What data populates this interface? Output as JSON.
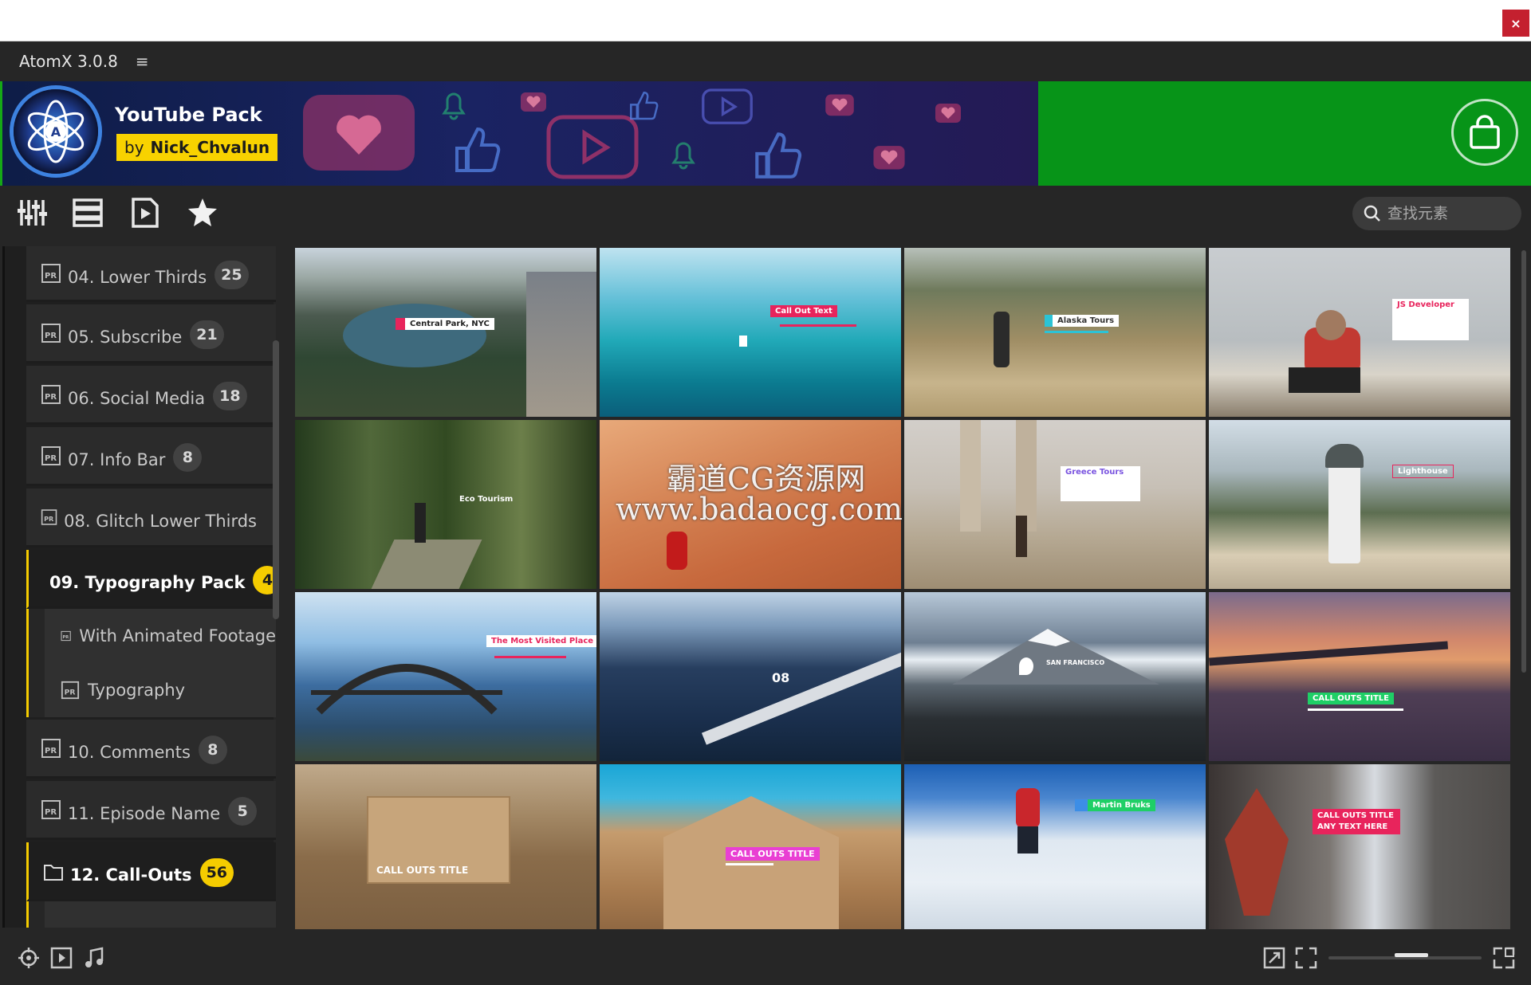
{
  "window": {
    "close_label": "×"
  },
  "app": {
    "title": "AtomX 3.0.8",
    "menu_icon": "hamburger-icon"
  },
  "banner": {
    "pack_title": "YouTube Pack",
    "author_prefix": "by",
    "author_name": "Nick_Chvalun",
    "accent_color": "#079418",
    "badge_color": "#f8d200"
  },
  "toolbar": {
    "icons": [
      "sliders-icon",
      "list-icon",
      "video-file-icon",
      "star-icon"
    ],
    "search_placeholder": "查找元素"
  },
  "sidebar": {
    "items": [
      {
        "label": "04. Lower Thirds",
        "count": "25"
      },
      {
        "label": "05. Subscribe",
        "count": "21"
      },
      {
        "label": "06. Social Media",
        "count": "18"
      },
      {
        "label": "07. Info Bar",
        "count": "8"
      },
      {
        "label": "08. Glitch Lower Thirds",
        "count": ""
      },
      {
        "label": "09. Typography Pack",
        "count": "4"
      },
      {
        "label": "10. Comments",
        "count": "8"
      },
      {
        "label": "11. Episode Name",
        "count": "5"
      },
      {
        "label": "12. Call-Outs",
        "count": "56"
      }
    ],
    "subitems": [
      {
        "label": "With Animated Footage"
      },
      {
        "label": "Typography"
      }
    ],
    "active_color": "#f5cc00"
  },
  "grid": {
    "tiles": [
      {
        "scene": "city-lake-aerial",
        "caption": "Central Park, NYC",
        "accent": "#e8245c"
      },
      {
        "scene": "turquoise-sea",
        "caption": "Call Out Text",
        "accent": "#e8245c"
      },
      {
        "scene": "hiker-hillside",
        "caption": "Alaska Tours",
        "accent": "#2bc3d6"
      },
      {
        "scene": "developer-desk",
        "caption": "JS Developer",
        "accent": "#e8245c"
      },
      {
        "scene": "forest-path",
        "caption": "Eco Tourism",
        "accent": "#ffffff"
      },
      {
        "scene": "desert-dunes",
        "caption": "",
        "accent": "#ffffff"
      },
      {
        "scene": "ancient-ruins",
        "caption": "Greece Tours",
        "accent": "#7a54e0"
      },
      {
        "scene": "lighthouse-coast",
        "caption": "Lighthouse",
        "accent": "#e8245c"
      },
      {
        "scene": "harbour-bridge",
        "caption": "The Most Visited Place",
        "accent": "#e8245c"
      },
      {
        "scene": "long-bridge",
        "caption": "08",
        "accent": "#3c6cf0"
      },
      {
        "scene": "mountain-town",
        "caption": "SAN FRANCISCO",
        "accent": "#ffffff"
      },
      {
        "scene": "sunset-bridge",
        "caption": "CALL OUTS TITLE",
        "accent": "#1fcf66"
      },
      {
        "scene": "desert-fortress",
        "caption": "CALL OUTS TITLE",
        "accent": "#ffffff"
      },
      {
        "scene": "old-facade",
        "caption": "CALL OUTS TITLE",
        "accent": "#e93fd3"
      },
      {
        "scene": "snow-skier",
        "caption": "Martin Bruks",
        "accent": "#1fcf66"
      },
      {
        "scene": "street-mural",
        "caption": "CALL OUTS TITLE ANY TEXT HERE",
        "accent": "#e8245c"
      }
    ]
  },
  "watermark": {
    "line1": "霸道CG资源网",
    "line2": "www.badaocg.com"
  },
  "bottombar": {
    "left_icons": [
      "target-icon",
      "play-box-icon",
      "music-note-icon"
    ],
    "right_icons": [
      "expand-icon",
      "fit-screen-icon",
      "layout-icon"
    ],
    "zoom_level": 0.55
  }
}
